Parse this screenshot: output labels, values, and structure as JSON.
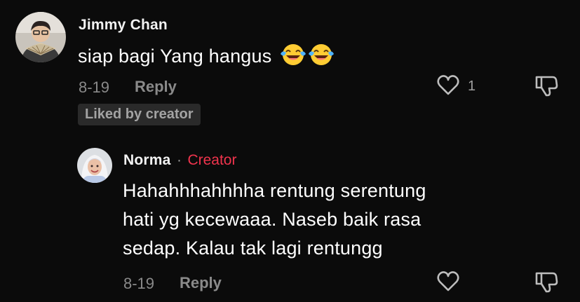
{
  "comment": {
    "username": "Jimmy Chan",
    "text": "siap bagi Yang hangus",
    "emojis": [
      "face-with-tears-of-joy",
      "face-with-tears-of-joy"
    ],
    "date": "8-19",
    "reply_label": "Reply",
    "like_count": "1",
    "liked_by_creator": "Liked by creator"
  },
  "reply": {
    "username": "Norma",
    "separator": "·",
    "creator_label": "Creator",
    "text_lines": [
      "Hahahhhahhhha rentung serentung",
      "hati yg kecewaaa. Naseb baik rasa",
      "sedap. Kalau tak lagi rentungg"
    ],
    "date": "8-19",
    "reply_label": "Reply"
  },
  "colors": {
    "background": "#0b0b0b",
    "creator_accent": "#f0344d",
    "muted_text": "#8a8a8a"
  },
  "icons": [
    "heart-outline-icon",
    "dislike-thumb-down-icon",
    "laughing-emoji-icon"
  ]
}
